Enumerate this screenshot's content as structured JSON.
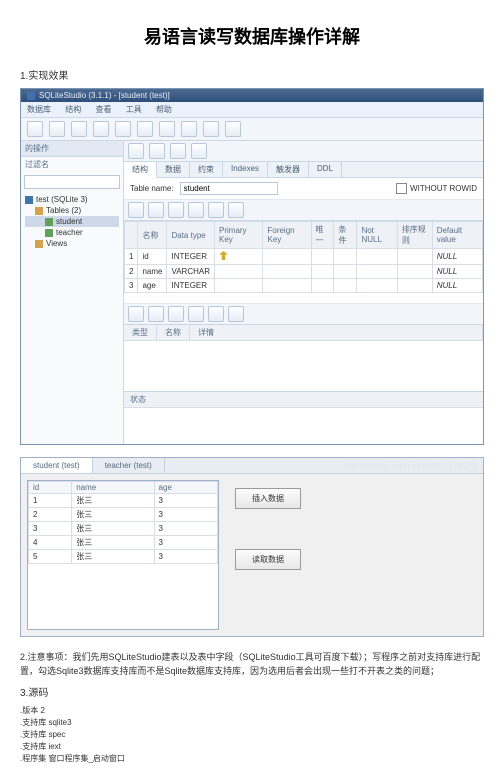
{
  "title": "易语言读写数据库操作详解",
  "section1": "1.实现效果",
  "sqlitestudio": {
    "title": "SQLiteStudio (3.1.1) - [student (test)]",
    "menu": [
      "数据库",
      "结构",
      "查看",
      "工具",
      "帮助"
    ],
    "side": {
      "header": "的操作",
      "filter_label": "过滤名",
      "tree": {
        "db": "test (SQLite 3)",
        "tables_label": "Tables (2)",
        "tables": [
          "student",
          "teacher"
        ],
        "views": "Views"
      }
    },
    "tabs": [
      "结构",
      "数据",
      "约束",
      "Indexes",
      "触发器",
      "DDL"
    ],
    "tablename_label": "Table name:",
    "tablename_value": "student",
    "without_rowid": "WITHOUT ROWID",
    "cols_header": [
      "名称",
      "Data type",
      "Primary Key",
      "Foreign Key",
      "唯一",
      "条件",
      "Not NULL",
      "排序规则",
      "Default value"
    ],
    "cols": [
      {
        "idx": "1",
        "name": "id",
        "type": "INTEGER",
        "pk": true,
        "default": "NULL"
      },
      {
        "idx": "2",
        "name": "name",
        "type": "VARCHAR",
        "pk": false,
        "default": "NULL"
      },
      {
        "idx": "3",
        "name": "age",
        "type": "INTEGER",
        "pk": false,
        "default": "NULL"
      }
    ],
    "sub_header": [
      "类型",
      "名称",
      "详情"
    ],
    "status_label": "状态"
  },
  "ewin": {
    "tabs": [
      "student (test)",
      "teacher (test)"
    ],
    "watermark": "https://blog.csdn.net/u010378579",
    "grid_header": [
      "id",
      "name",
      "age"
    ],
    "rows": [
      {
        "id": "1",
        "name": "张三",
        "age": "3"
      },
      {
        "id": "2",
        "name": "张三",
        "age": "3"
      },
      {
        "id": "3",
        "name": "张三",
        "age": "3"
      },
      {
        "id": "4",
        "name": "张三",
        "age": "3"
      },
      {
        "id": "5",
        "name": "张三",
        "age": "3"
      }
    ],
    "btn_insert": "插入数据",
    "btn_read": "读取数据"
  },
  "section2_label": "2.注意事项：我们先用SQLiteStudio建表以及表中字段（SQLiteStudio工具可百度下载）；写程序之前对支持库进行配置，勾选Sqlite3数据库支持库而不是Sqlite数据库支持库，因为选用后者会出现一些打不开表之类的问题；",
  "section3_label": "3.源码",
  "code": [
    ".版本 2",
    ".支持库 sqlite3",
    ".支持库 spec",
    ".支持库 iext",
    "",
    ".程序集 窗口程序集_启动窗口"
  ]
}
